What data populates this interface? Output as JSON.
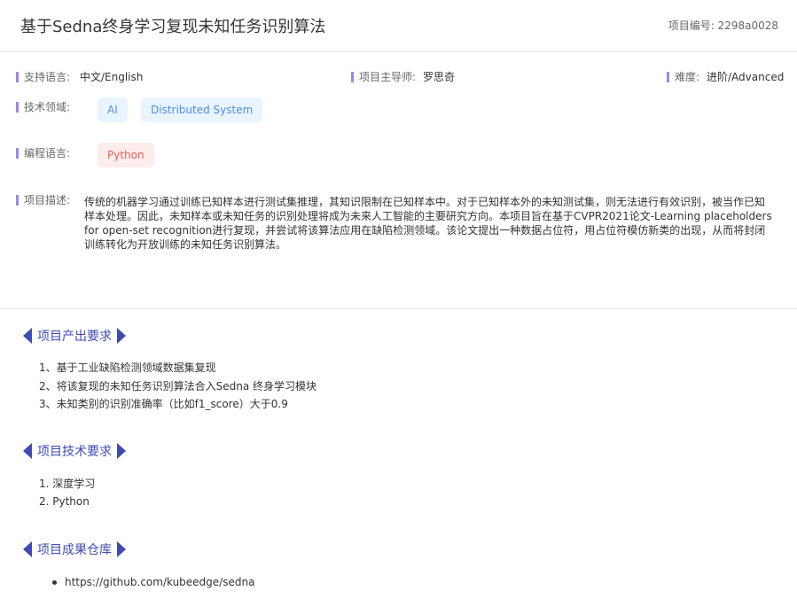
{
  "header": {
    "title": "基于Sedna终身学习复现未知任务识别算法",
    "project_id": "项目编号: 2298a0028"
  },
  "meta": {
    "language_label": "支持语言:",
    "language_value": "中文/English",
    "mentor_label": "项目主导师:",
    "mentor_value": "罗思奇",
    "difficulty_label": "难度:",
    "difficulty_value": "进阶/Advanced",
    "tech_label": "技术领域:",
    "tech_tags": [
      "AI",
      "Distributed System"
    ],
    "prog_label": "编程语言:",
    "prog_tags": [
      "Python"
    ],
    "desc_label": "项目描述:",
    "description": "传统的机器学习通过训练已知样本进行测试集推理，其知识限制在已知样本中。对于已知样本外的未知测试集，则无法进行有效识别，被当作已知样本处理。因此，未知样本或未知任务的识别处理将成为未来人工智能的主要研究方向。本项目旨在基于CVPR2021论文-Learning placeholders for open-set recognition进行复现，并尝试将该算法应用在缺陷检测领域。该论文提出一种数据占位符，用占位符模仿新类的出现，从而将封闭训练转化为开放训练的未知任务识别算法。"
  },
  "sections": {
    "output": {
      "title": "项目产出要求",
      "items": [
        "1、基于工业缺陷检测领域数据集复现",
        "2、将该复现的未知任务识别算法合入Sedna 终身学习模块",
        "3、未知类别的识别准确率（比如f1_score）大于0.9"
      ]
    },
    "tech": {
      "title": "项目技术要求",
      "items": [
        "1. 深度学习",
        "2. Python"
      ]
    },
    "repo": {
      "title": "项目成果仓库",
      "link": "https://github.com/kubeedge/sedna"
    }
  },
  "colors": {
    "accent": "#3f4bb3",
    "label_bar": "#9d87e8",
    "tag_blue_bg": "#eaf4ff",
    "tag_blue_text": "#4a90e2",
    "tag_red_bg": "#fdecec",
    "tag_red_text": "#e0605e"
  }
}
